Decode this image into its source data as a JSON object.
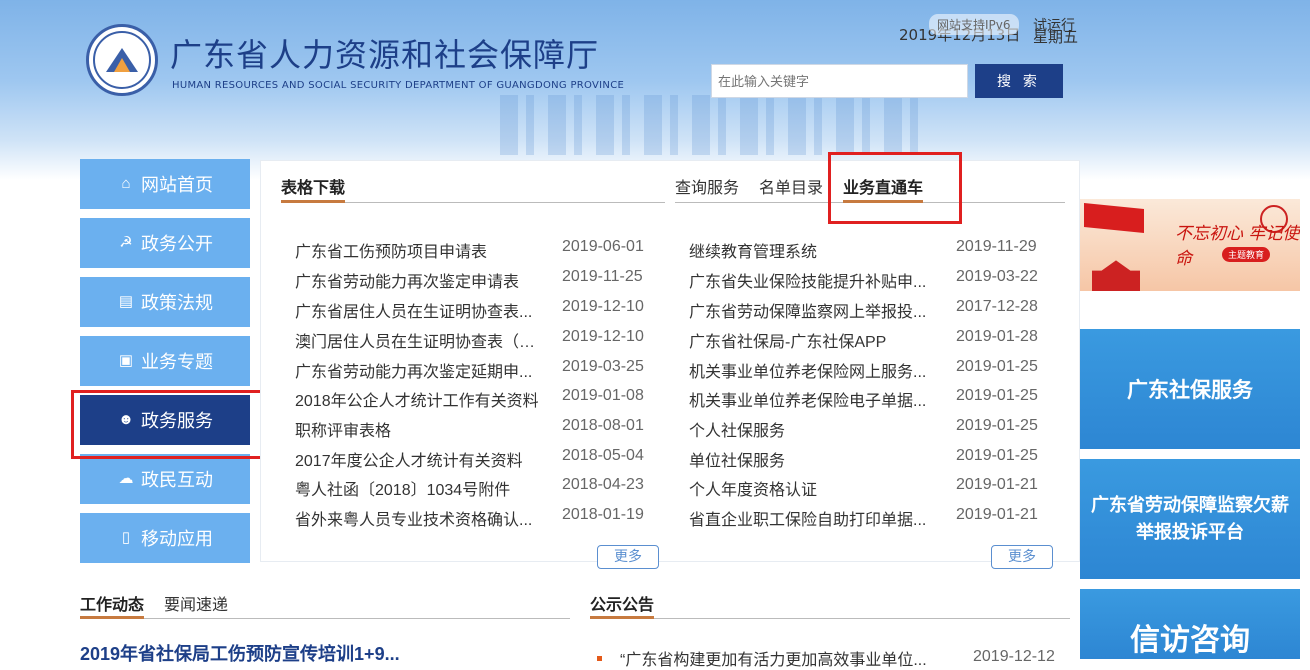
{
  "header": {
    "title_cn": "广东省人力资源和社会保障厅",
    "title_en": "HUMAN RESOURCES AND SOCIAL SECURITY DEPARTMENT OF GUANGDONG PROVINCE",
    "ipv6_badge": "网站支持IPv6",
    "trial_label": "试运行",
    "date": "2019年12月13日",
    "weekday": "星期五",
    "search": {
      "placeholder": "在此输入关键字",
      "button": "搜 索"
    }
  },
  "nav": [
    {
      "label": "网站首页",
      "icon": "home-icon"
    },
    {
      "label": "政务公开",
      "icon": "emblem-icon"
    },
    {
      "label": "政策法规",
      "icon": "document-icon"
    },
    {
      "label": "业务专题",
      "icon": "folder-icon"
    },
    {
      "label": "政务服务",
      "icon": "user-service-icon",
      "active": true
    },
    {
      "label": "政民互动",
      "icon": "chat-icon"
    },
    {
      "label": "移动应用",
      "icon": "mobile-icon"
    }
  ],
  "forms": {
    "title": "表格下载",
    "more": "更多",
    "items": [
      {
        "title": "广东省工伤预防项目申请表",
        "date": "2019-06-01"
      },
      {
        "title": "广东省劳动能力再次鉴定申请表",
        "date": "2019-11-25"
      },
      {
        "title": "广东省居住人员在生证明协查表...",
        "date": "2019-12-10"
      },
      {
        "title": "澳门居住人员在生证明协查表（2...",
        "date": "2019-12-10"
      },
      {
        "title": "广东省劳动能力再次鉴定延期申...",
        "date": "2019-03-25"
      },
      {
        "title": "2018年公企人才统计工作有关资料",
        "date": "2019-01-08"
      },
      {
        "title": "职称评审表格",
        "date": "2018-08-01"
      },
      {
        "title": "2017年度公企人才统计有关资料",
        "date": "2018-05-04"
      },
      {
        "title": "粤人社函〔2018〕1034号附件",
        "date": "2018-04-23"
      },
      {
        "title": "省外来粤人员专业技术资格确认...",
        "date": "2018-01-19"
      }
    ]
  },
  "services": {
    "tabs": [
      "查询服务",
      "名单目录",
      "业务直通车"
    ],
    "more": "更多",
    "items": [
      {
        "title": "继续教育管理系统",
        "date": "2019-11-29"
      },
      {
        "title": "广东省失业保险技能提升补贴申...",
        "date": "2019-03-22"
      },
      {
        "title": "广东省劳动保障监察网上举报投...",
        "date": "2017-12-28"
      },
      {
        "title": "广东省社保局-广东社保APP",
        "date": "2019-01-28"
      },
      {
        "title": "机关事业单位养老保险网上服务...",
        "date": "2019-01-25"
      },
      {
        "title": "机关事业单位养老保险电子单据...",
        "date": "2019-01-25"
      },
      {
        "title": "个人社保服务",
        "date": "2019-01-25"
      },
      {
        "title": "单位社保服务",
        "date": "2019-01-25"
      },
      {
        "title": "个人年度资格认证",
        "date": "2019-01-21"
      },
      {
        "title": "省直企业职工保险自助打印单据...",
        "date": "2019-01-21"
      }
    ]
  },
  "banners": {
    "red": {
      "text": "不忘初心 牢记使命",
      "sub": "主题教育"
    },
    "social": "广东社保服务",
    "labor": "广东省劳动保障监察欠薪举报投诉平台",
    "petition": "信访咨询"
  },
  "bottom": {
    "work_tabs": [
      "工作动态",
      "要闻速递"
    ],
    "news_headline": "2019年省社保局工伤预防宣传培训1+9...",
    "notice_title": "公示公告",
    "notice_item": "“广东省构建更加有活力更加高效事业单位...",
    "notice_date": "2019-12-12"
  },
  "colors": {
    "primary_blue": "#1d3f88",
    "nav_blue": "#6bb0ef",
    "accent_orange": "#c77a3f",
    "highlight_red": "#e02020"
  }
}
